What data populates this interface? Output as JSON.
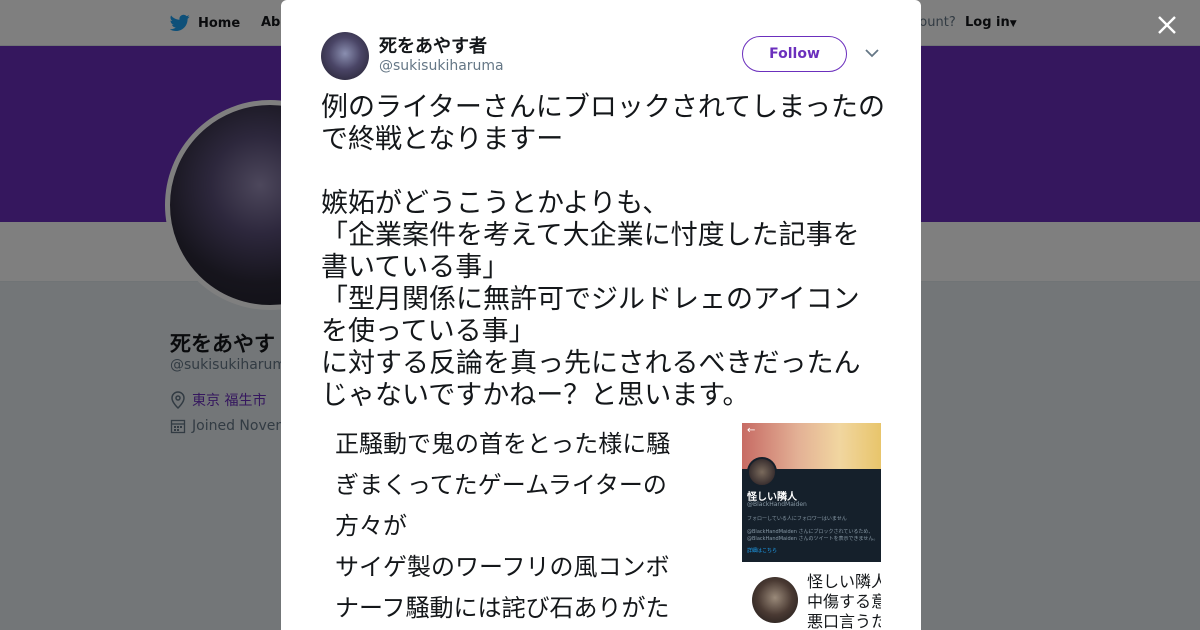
{
  "nav": {
    "home": "Home",
    "about": "Abo",
    "account_prompt": "ccount?",
    "login": "Log in"
  },
  "profile": {
    "name": "死をあやす",
    "handle": "@sukisukiharuma",
    "location": "東京 福生市",
    "joined": "Joined Novem"
  },
  "modal": {
    "close_icon": "close-icon",
    "author": {
      "name": "死をあやす者",
      "handle": "@sukisukiharuma"
    },
    "follow_label": "Follow",
    "tweet_text": "例のライターさんにブロックされてしまったので終戦となりますー\n\n嫉妬がどうこうとかよりも、\n「企業案件を考えて大企業に忖度した記事を書いている事」\n「型月関係に無許可でジルドレェのアイコンを使っている事」\nに対する反論を真っ先にされるべきだったんじゃないですかねー？と思います。",
    "embedded": {
      "left_text": "正騒動で鬼の首をとった様に騒\nぎまくってたゲームライターの\n方々が\nサイゲ製のワーフリの風コンボ\nナーフ騒動には詫び石ありがた",
      "screenshot": {
        "back_arrow": "←",
        "name": "怪しい隣人",
        "handle": "@BlackHandMaiden",
        "note": "フォローしている人にフォロワーはいません",
        "block_note": "@BlackHandMaiden さんにブロックされているため、@BlackHandMaiden さんのツイートを表示できません。",
        "link": "詳細はこちら"
      },
      "reply_lines": "怪しい隣人\n中傷する意\n悪口言うた"
    }
  },
  "colors": {
    "brand_purple": "#6b2fbd",
    "twitter_blue": "#1da1f2"
  }
}
